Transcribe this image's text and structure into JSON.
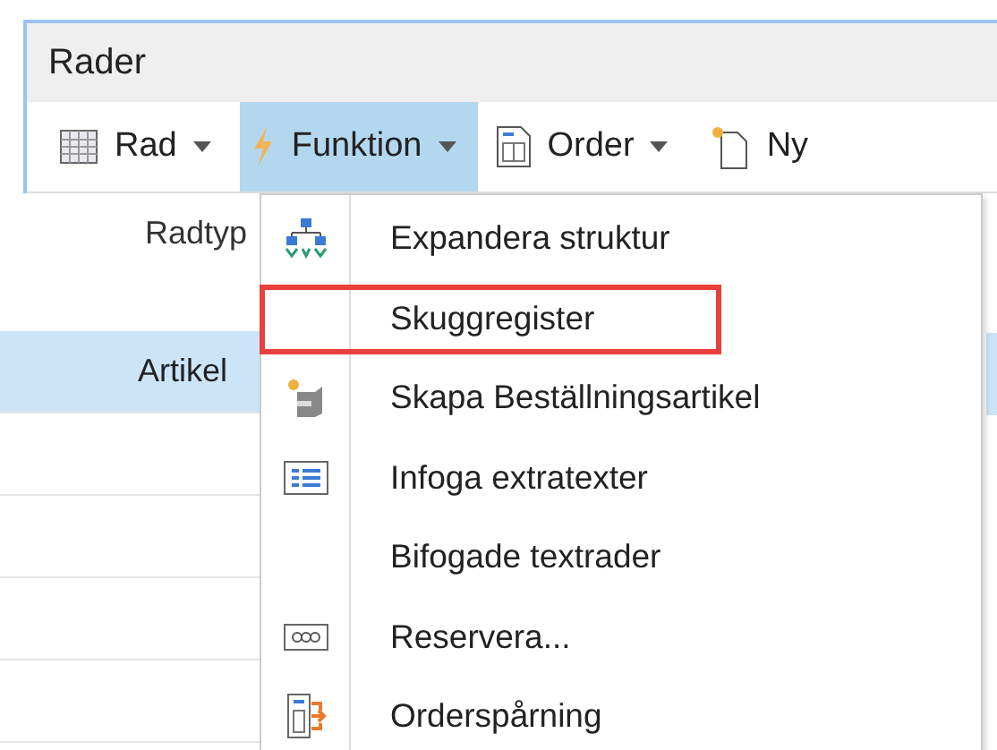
{
  "panel": {
    "title": "Rader"
  },
  "toolbar": [
    {
      "kind": "grid",
      "label": "Rad",
      "caret": true,
      "selected": false
    },
    {
      "kind": "bolt",
      "label": "Funktion",
      "caret": true,
      "selected": true
    },
    {
      "kind": "document",
      "label": "Order",
      "caret": true,
      "selected": false
    },
    {
      "kind": "new",
      "label": "Ny",
      "caret": false,
      "selected": false
    }
  ],
  "table": {
    "columns": [
      "Radtyp"
    ],
    "rows": [
      {
        "radtyp": "Artikel",
        "selected": true
      }
    ]
  },
  "menu": {
    "items": [
      {
        "kind": "hierarchy",
        "label": "Expandera struktur",
        "marked": false
      },
      {
        "kind": "plain",
        "label": "Skuggregister",
        "marked": true
      },
      {
        "kind": "box",
        "label": "Skapa Beställningsartikel",
        "marked": false
      },
      {
        "kind": "list",
        "label": "Infoga extratexter",
        "marked": false
      },
      {
        "kind": "plain",
        "label": "Bifogade textrader",
        "marked": false
      },
      {
        "kind": "reserve",
        "label": "Reservera...",
        "marked": false
      },
      {
        "kind": "tracking",
        "label": "Orderspårning",
        "marked": false
      }
    ]
  }
}
